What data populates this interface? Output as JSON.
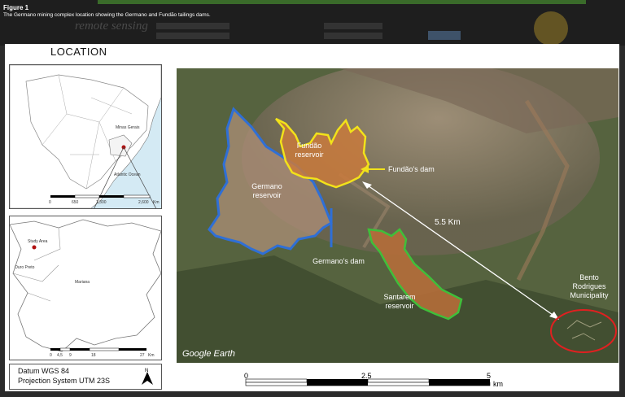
{
  "figure": {
    "label": "Figure 1",
    "caption": "The Germano mining complex location showing the Germano and Fundão tailings dams."
  },
  "title": "LOCATION",
  "background_ui": {
    "logo": "remote sensing"
  },
  "brazil_inset": {
    "region_label": "Minas Gerais",
    "ocean_label": "Atlantic Ocean",
    "scale_ticks": [
      "0",
      "650",
      "1,300",
      "2,600"
    ],
    "scale_unit": "Km"
  },
  "local_inset": {
    "study_area": "Study Area",
    "ouro_preto": "Ouro Preto",
    "mariana": "Mariana",
    "scale_ticks": [
      "0",
      "4,5",
      "9",
      "18",
      "27"
    ],
    "scale_unit": "Km"
  },
  "datum": {
    "line1": "Datum WGS 84",
    "line2": "Projection System UTM 23S",
    "north": "N"
  },
  "satellite": {
    "fundao_reservoir": "Fundão reservoir",
    "fundao_dam": "Fundão's dam",
    "germano_reservoir": "Germano reservoir",
    "germano_dam": "Germano's dam",
    "santarem_reservoir": "Santarem reservoir",
    "distance": "5.5 Km",
    "bento": "Bento Rodrigues Municipality",
    "source": "Google Earth"
  },
  "scalebar": {
    "ticks": [
      "0",
      "2.5",
      "5"
    ],
    "unit": "km"
  },
  "colors": {
    "germano_outline": "#2f6fd6",
    "fundao_outline": "#f2e21a",
    "santarem_outline": "#3fbf3a",
    "bento_circle": "#e02020"
  }
}
